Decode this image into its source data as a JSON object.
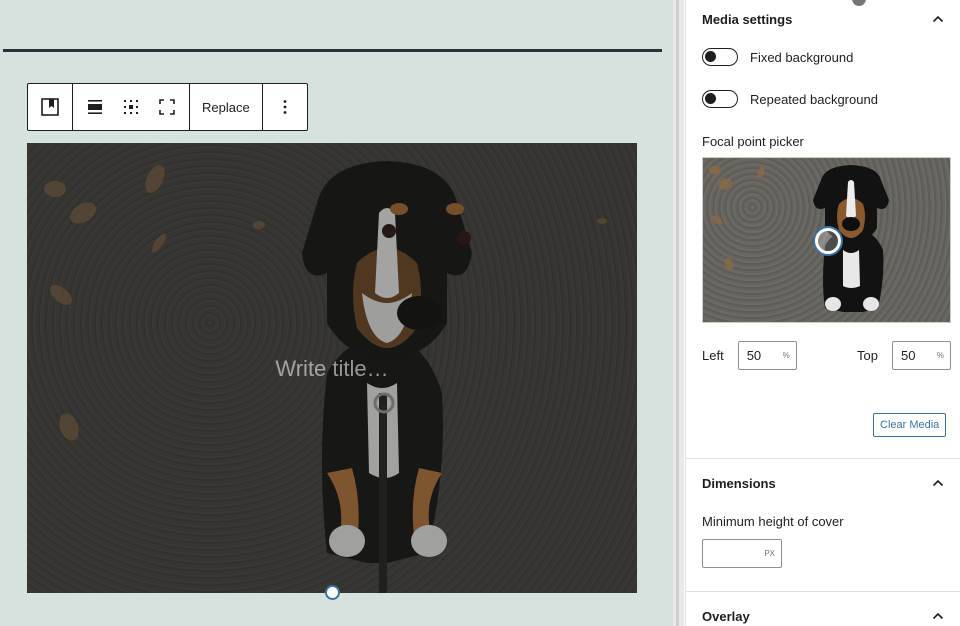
{
  "toolbar": {
    "replace_label": "Replace"
  },
  "cover": {
    "title_placeholder": "Write title…"
  },
  "sidebar": {
    "media_settings": {
      "title": "Media settings",
      "fixed_background_label": "Fixed background",
      "fixed_background_on": false,
      "repeated_background_label": "Repeated background",
      "repeated_background_on": false,
      "focal_point_label": "Focal point picker",
      "left_label": "Left",
      "left_value": "50",
      "left_unit": "%",
      "top_label": "Top",
      "top_value": "50",
      "top_unit": "%",
      "clear_media_label": "Clear Media"
    },
    "dimensions": {
      "title": "Dimensions",
      "min_height_label": "Minimum height of cover",
      "min_height_value": "",
      "min_height_unit": "PX"
    },
    "overlay": {
      "title": "Overlay"
    }
  },
  "colors": {
    "canvas_bg": "#d6e2dd",
    "accent": "#3a73a3",
    "text": "#1e1e1e"
  }
}
